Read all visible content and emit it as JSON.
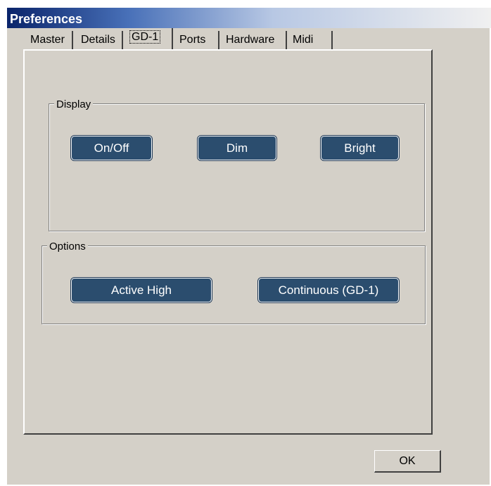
{
  "window": {
    "title": "Preferences"
  },
  "tabs": [
    {
      "label": "Master"
    },
    {
      "label": "Details"
    },
    {
      "label": "GD-1",
      "selected": true
    },
    {
      "label": "Ports"
    },
    {
      "label": "Hardware"
    },
    {
      "label": "Midi"
    }
  ],
  "display_group": {
    "label": "Display",
    "buttons": {
      "on_off": "On/Off",
      "dim": "Dim",
      "bright": "Bright"
    }
  },
  "options_group": {
    "label": "Options",
    "buttons": {
      "active_high": "Active High",
      "continuous": "Continuous (GD-1)"
    }
  },
  "footer": {
    "ok_label": "OK"
  },
  "colors": {
    "titlebar": "#0a246a",
    "button_fill": "#2b4d6e",
    "dialog_bg": "#d4d0c8"
  }
}
